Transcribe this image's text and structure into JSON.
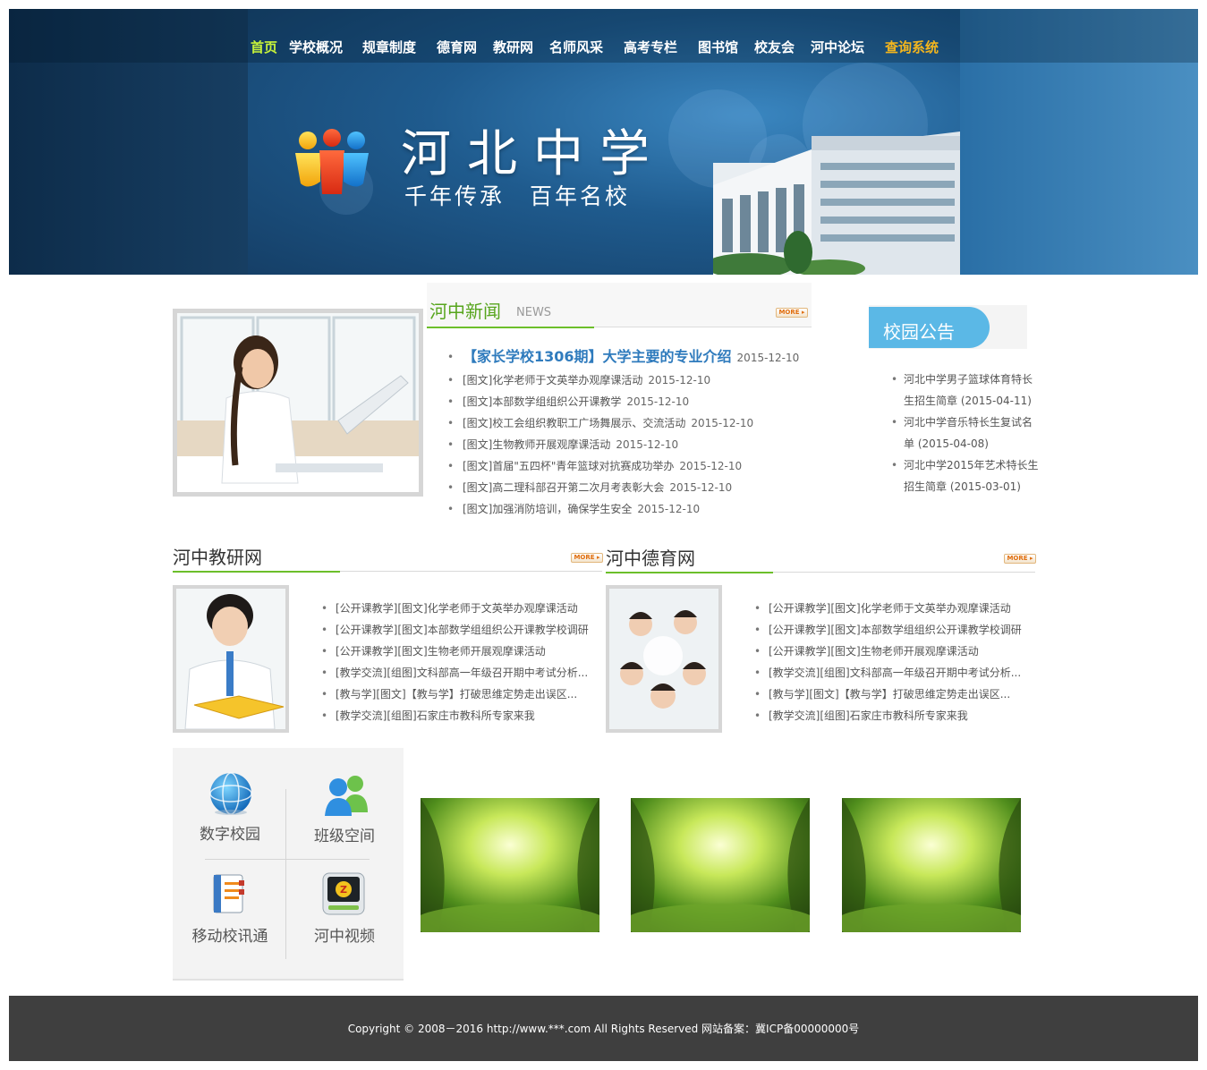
{
  "nav": {
    "items": [
      {
        "label": "首页",
        "state": "active"
      },
      {
        "label": "学校概况",
        "state": "normal"
      },
      {
        "label": "规章制度",
        "state": "normal"
      },
      {
        "label": "德育网",
        "state": "normal"
      },
      {
        "label": "教研网",
        "state": "normal"
      },
      {
        "label": "名师风采",
        "state": "normal"
      },
      {
        "label": "高考专栏",
        "state": "normal"
      },
      {
        "label": "图书馆",
        "state": "normal"
      },
      {
        "label": "校友会",
        "state": "normal"
      },
      {
        "label": "河中论坛",
        "state": "normal"
      },
      {
        "label": "查询系统",
        "state": "highlight"
      }
    ]
  },
  "banner": {
    "title": "河北中学",
    "slogan": "千年传承　百年名校"
  },
  "news": {
    "title": "河中新闻",
    "title_en": "NEWS",
    "more": "MORE",
    "featured": {
      "title": "【家长学校1306期】大学主要的专业介绍",
      "date": "2015-12-10"
    },
    "items": [
      {
        "title": "[图文]化学老师于文英举办观摩课活动",
        "date": "2015-12-10"
      },
      {
        "title": "[图文]本部数学组组织公开课教学",
        "date": "2015-12-10"
      },
      {
        "title": "[图文]校工会组织教职工广场舞展示、交流活动",
        "date": "2015-12-10"
      },
      {
        "title": "[图文]生物教师开展观摩课活动",
        "date": "2015-12-10"
      },
      {
        "title": "[图文]首届\"五四杯\"青年篮球对抗赛成功举办",
        "date": "2015-12-10"
      },
      {
        "title": "[图文]高二理科部召开第二次月考表彰大会",
        "date": "2015-12-10"
      },
      {
        "title": "[图文]加强消防培训，确保学生安全",
        "date": "2015-12-10"
      }
    ]
  },
  "notice": {
    "title": "校园公告",
    "items": [
      "河北中学男子篮球体育特长生招生简章 (2015-04-11)",
      "河北中学音乐特长生复试名单 (2015-04-08)",
      "河北中学2015年艺术特长生招生简章 (2015-03-01)"
    ]
  },
  "jiaoyan": {
    "title": "河中教研网",
    "more": "MORE",
    "items": [
      "[公开课教学][图文]化学老师于文英举办观摩课活动",
      "[公开课教学][图文]本部数学组组织公开课教学校调研",
      "[公开课教学][图文]生物老师开展观摩课活动",
      "[教学交流][组图]文科部高一年级召开期中考试分析...",
      "[教与学][图文]【教与学】打破思维定势走出误区...",
      "[教学交流][组图]石家庄市教科所专家来我"
    ]
  },
  "deyu": {
    "title": "河中德育网",
    "more": "MORE",
    "items": [
      "[公开课教学][图文]化学老师于文英举办观摩课活动",
      "[公开课教学][图文]本部数学组组织公开课教学校调研",
      "[公开课教学][图文]生物老师开展观摩课活动",
      "[教学交流][组图]文科部高一年级召开期中考试分析...",
      "[教与学][图文]【教与学】打破思维定势走出误区...",
      "[教学交流][组图]石家庄市教科所专家来我"
    ]
  },
  "quick_links": [
    {
      "label": "数字校园",
      "icon": "globe-icon"
    },
    {
      "label": "班级空间",
      "icon": "users-icon"
    },
    {
      "label": "移动校讯通",
      "icon": "notebook-icon"
    },
    {
      "label": "河中视频",
      "icon": "video-player-icon"
    }
  ],
  "footer": {
    "text": "Copyright © 2008－2016 http://www.***.com All Rights Reserved 网站备案：冀ICP备00000000号"
  },
  "colors": {
    "accent_green": "#6cbf2a",
    "nav_active": "#c6f23a",
    "nav_highlight": "#f2b51e",
    "notice_blue": "#5bb8e6",
    "footer_bg": "#3f3f3f"
  }
}
